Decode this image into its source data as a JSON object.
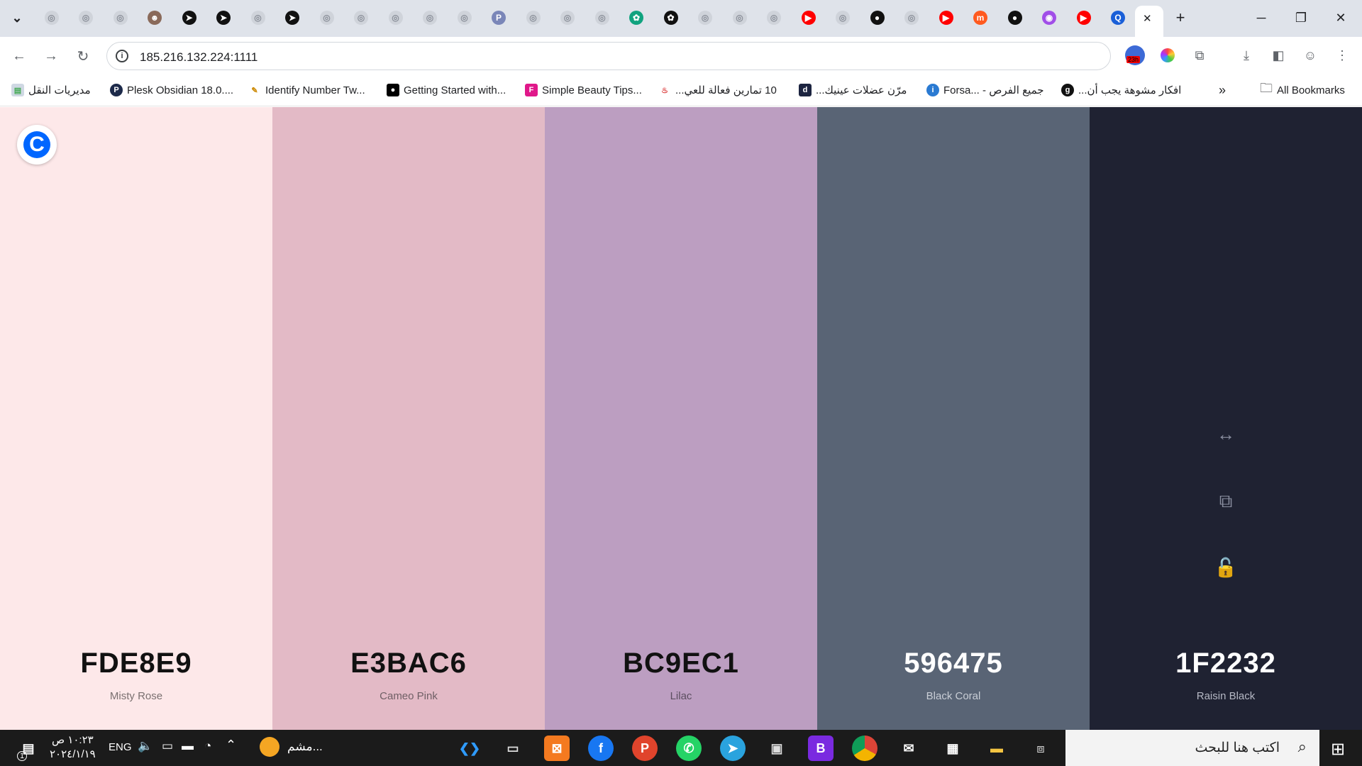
{
  "browser": {
    "url": "185.216.132.224:1111",
    "tabs_icons": [
      "chevron-down-icon",
      "globe-icon",
      "globe-icon",
      "globe-icon",
      "avatar-icon",
      "telegram-icon",
      "telegram-icon",
      "globe-icon",
      "telegram-icon",
      "globe-icon",
      "globe-icon",
      "globe-icon",
      "globe-icon",
      "globe-icon",
      "php-icon",
      "globe-icon",
      "globe-icon",
      "globe-icon",
      "chatgpt-icon",
      "openai-icon",
      "globe-icon",
      "globe-icon",
      "globe-icon",
      "youtube-icon",
      "globe-icon",
      "github-icon",
      "globe-icon",
      "youtube-icon",
      "m-icon",
      "github-icon",
      "discord-icon",
      "youtube-icon",
      "q-icon"
    ],
    "new_tab": "+",
    "close_tab": "✕"
  },
  "bookmarks": [
    {
      "label": "مديريات النقل"
    },
    {
      "label": "Plesk Obsidian 18.0...."
    },
    {
      "label": "Identify Number Tw..."
    },
    {
      "label": "Getting Started with..."
    },
    {
      "label": "Simple Beauty Tips..."
    },
    {
      "label": "10 تمارين فعالة للعي..."
    },
    {
      "label": "مرّن عضلات عينيك..."
    },
    {
      "label": "Forsa... - جميع الفرص"
    },
    {
      "label": "افكار مشوهة يجب أن..."
    },
    {
      "label": "All Bookmarks"
    }
  ],
  "extension_badge": "23h",
  "palette": {
    "logo_letter": "C",
    "colors": [
      {
        "hex": "FDE8E9",
        "name": "Misty Rose",
        "bg": "#FDE8E9",
        "hex_color": "#111111",
        "name_color": "#7a7070"
      },
      {
        "hex": "E3BAC6",
        "name": "Cameo Pink",
        "bg": "#E3BAC6",
        "hex_color": "#111111",
        "name_color": "#6f5f65"
      },
      {
        "hex": "BC9EC1",
        "name": "Lilac",
        "bg": "#BC9EC1",
        "hex_color": "#111111",
        "name_color": "#5c4f60"
      },
      {
        "hex": "596475",
        "name": "Black Coral",
        "bg": "#596475",
        "hex_color": "#ffffff",
        "name_color": "#c9ced6"
      },
      {
        "hex": "1F2232",
        "name": "Raisin Black",
        "bg": "#1F2232",
        "hex_color": "#ffffff",
        "name_color": "#b5b8c4"
      }
    ],
    "tools": [
      "drag-arrows-icon",
      "copy-icon",
      "unlock-icon"
    ]
  },
  "taskbar": {
    "time": "١٠:٢٣ ص",
    "date": "٢٠٢٤/١/١٩",
    "lang": "ENG",
    "weather": "مشم...",
    "search_placeholder": "اكتب هنا للبحث",
    "notification_count": "1"
  }
}
